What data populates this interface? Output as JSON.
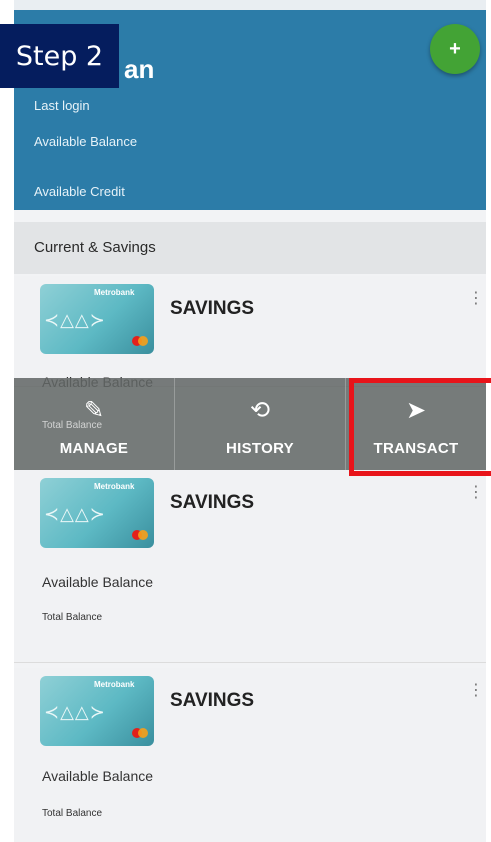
{
  "overlay": {
    "step_label": "Step 2"
  },
  "header": {
    "name_fragment": "an",
    "last_login_label": "Last login",
    "available_balance_label": "Available Balance",
    "available_credit_label": "Available Credit",
    "fab_icon": "+"
  },
  "section": {
    "title": "Current & Savings"
  },
  "accounts": [
    {
      "card_bank": "Metrobank",
      "title": "SAVINGS",
      "available_balance_label": "Available Balance",
      "total_balance_label": "Total Balance"
    },
    {
      "card_bank": "Metrobank",
      "title": "SAVINGS",
      "available_balance_label": "Available Balance",
      "total_balance_label": "Total Balance"
    },
    {
      "card_bank": "Metrobank",
      "title": "SAVINGS",
      "available_balance_label": "Available Balance",
      "total_balance_label": "Total Balance"
    }
  ],
  "actions": [
    {
      "label": "MANAGE",
      "icon": "pencil-icon",
      "glyph": "✎"
    },
    {
      "label": "HISTORY",
      "icon": "history-icon",
      "glyph": "⟲"
    },
    {
      "label": "TRANSACT",
      "icon": "send-icon",
      "glyph": "➤"
    }
  ],
  "colors": {
    "header_bg": "#2c7ca8",
    "fab_bg": "#43a335",
    "step_bg": "#051d5e",
    "highlight_border": "#e8141a",
    "action_bar_bg": "#626765"
  }
}
